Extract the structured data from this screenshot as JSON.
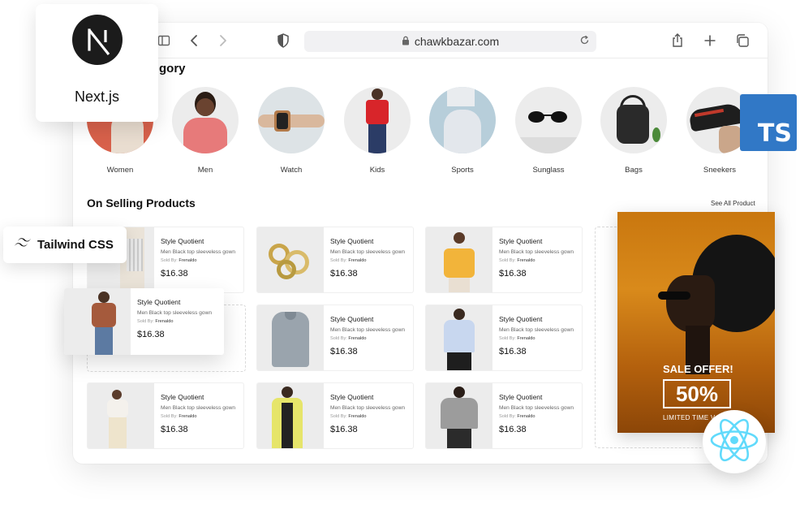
{
  "browser": {
    "url": "chawkbazar.com"
  },
  "categories": {
    "title": "gory",
    "items": [
      {
        "label": "Women"
      },
      {
        "label": "Men"
      },
      {
        "label": "Watch"
      },
      {
        "label": "Kids"
      },
      {
        "label": "Sports"
      },
      {
        "label": "Sunglass"
      },
      {
        "label": "Bags"
      },
      {
        "label": "Sneekers"
      }
    ]
  },
  "selling": {
    "title": "On Selling Products",
    "see_all": "See All Product"
  },
  "product": {
    "brand": "Style Quotient",
    "description": "Men Black top sleeveless gown",
    "sold_by_label": "Sold By:",
    "seller": "Frenaldo",
    "price": "$16.38"
  },
  "banner": {
    "title": "SALE OFFER!",
    "discount": "50%",
    "subtitle": "LIMITED TIME V"
  },
  "badges": {
    "nextjs": "Next.js",
    "tailwind": "Tailwind CSS",
    "typescript": "TS"
  },
  "colors": {
    "typescript": "#3178c6",
    "react": "#61dafb",
    "tailwind": "#38bdf8",
    "banner": "#d98a1b"
  }
}
